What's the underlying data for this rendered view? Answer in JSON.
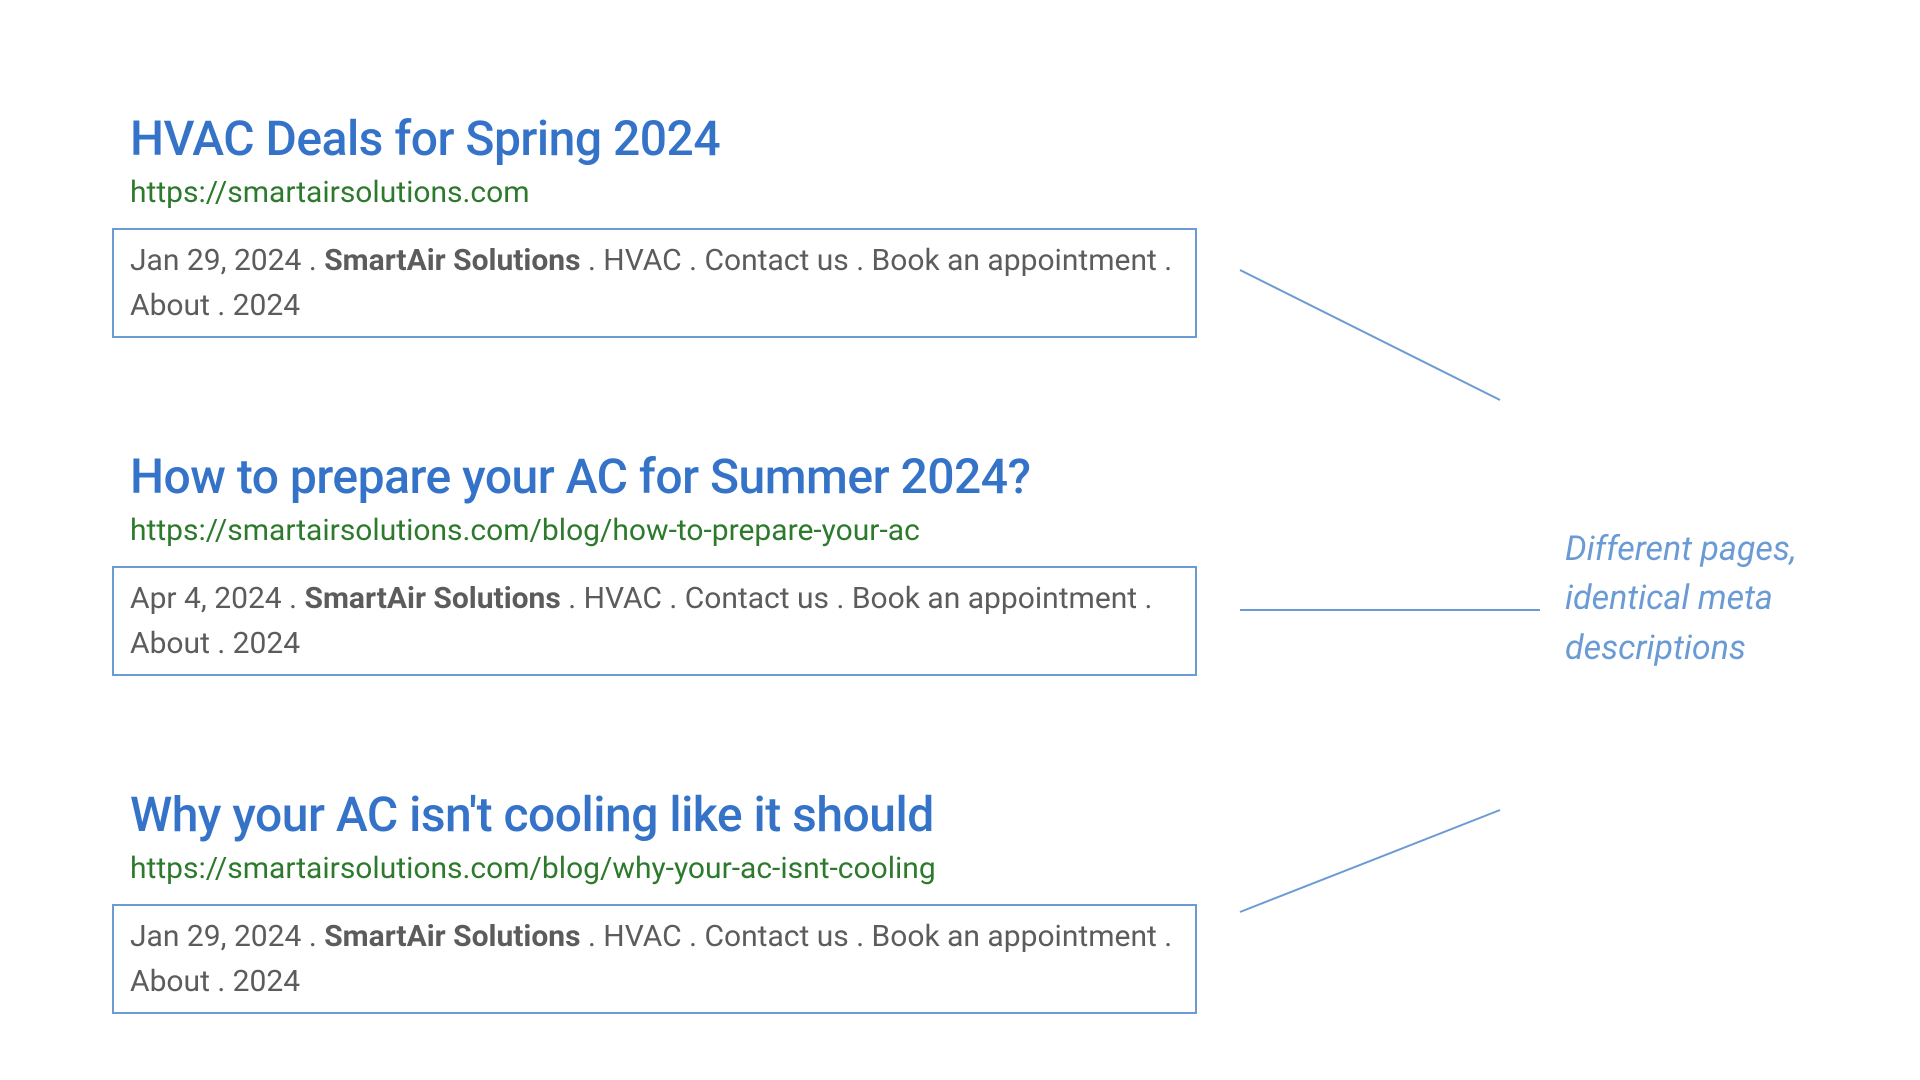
{
  "results": [
    {
      "title": "HVAC Deals for Spring 2024",
      "url": "https://smartairsolutions.com",
      "snippet_date": "Jan 29, 2024 . ",
      "snippet_bold": "SmartAir Solutions",
      "snippet_rest": " . HVAC . Contact us . Book an appointment . About . 2024"
    },
    {
      "title": "How to prepare your AC for Summer 2024?",
      "url": "https://smartairsolutions.com/blog/how-to-prepare-your-ac",
      "snippet_date": "Apr 4, 2024 . ",
      "snippet_bold": "SmartAir Solutions",
      "snippet_rest": " . HVAC . Contact us . Book an appointment . About . 2024"
    },
    {
      "title": "Why your AC isn't cooling like it should",
      "url": "https://smartairsolutions.com/blog/why-your-ac-isnt-cooling",
      "snippet_date": "Jan 29, 2024 . ",
      "snippet_bold": "SmartAir Solutions",
      "snippet_rest": " . HVAC . Contact us . Book an appointment . About . 2024"
    }
  ],
  "annotation": "Different pages, identical meta descriptions"
}
